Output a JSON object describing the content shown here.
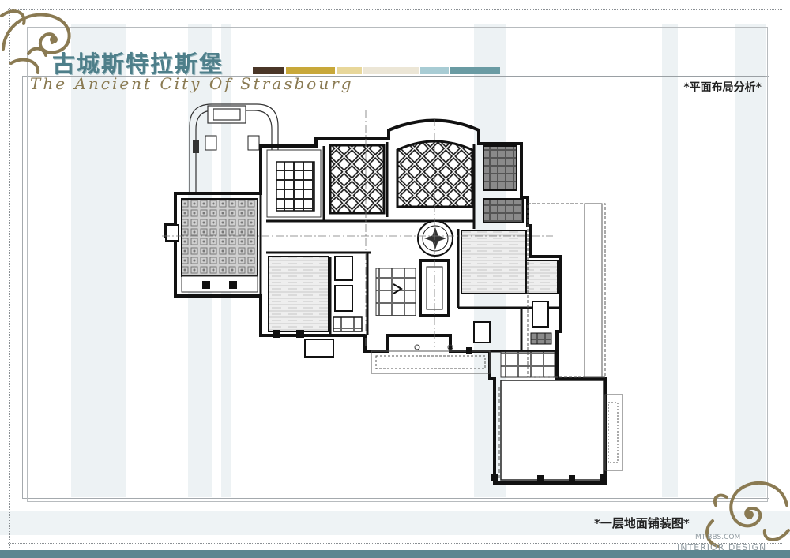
{
  "title": {
    "chinese": "古城斯特拉斯堡",
    "english": "The Ancient City Of Strasbourg"
  },
  "section_label": "*平面布局分析*",
  "caption": "*一层地面铺装图*",
  "watermark": {
    "url": "MT-BBS.COM",
    "brand": "INTERIOR DESIGN"
  },
  "colors": {
    "palette": [
      "#4a3628",
      "#c8a83a",
      "#e8d79a",
      "#ece6d6",
      "#a8ccd4",
      "#6a9ba3"
    ],
    "title_blue": "#4e7f8a",
    "ornament_brown": "#8a7a52",
    "bottom_band": "#5d8690"
  },
  "icons": {
    "top_left_ornament": "scroll-ornament-icon",
    "bottom_right_ornament": "scroll-ornament-icon",
    "stair_arrow": "arrow-icon"
  }
}
